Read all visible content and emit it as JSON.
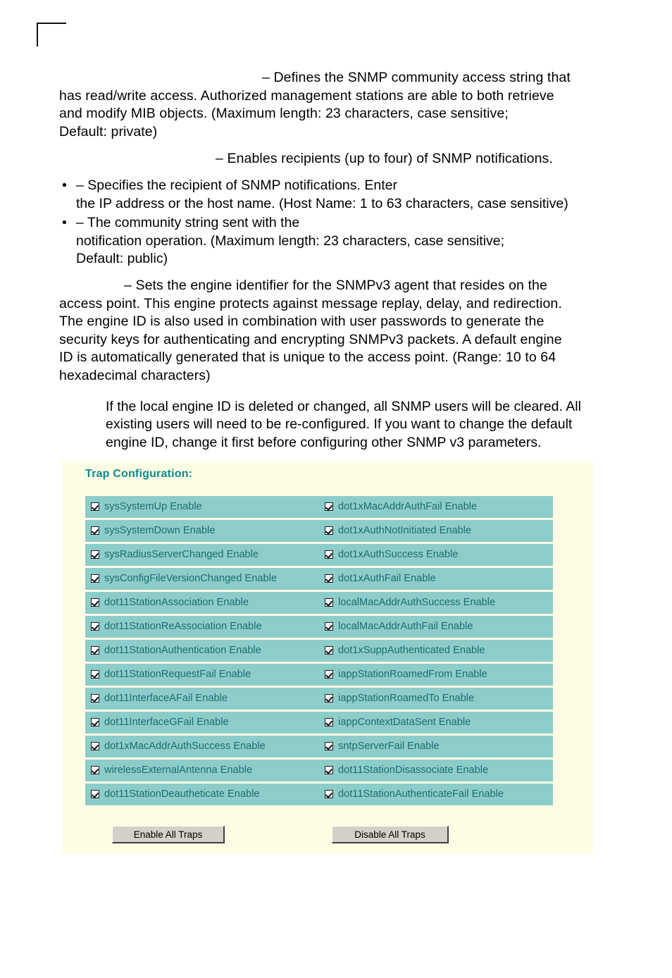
{
  "document": {
    "paragraph_rw_community": "– Defines the SNMP community access string that has read/write access. Authorized management stations are able to both retrieve and modify MIB objects. (Maximum length: 23 characters, case sensitive; Default: private)",
    "paragraph_rw_community_line1": "– Defines the SNMP community access string that",
    "paragraph_rw_community_line2": "has read/write access. Authorized management stations are able to both retrieve",
    "paragraph_rw_community_line3": "and modify MIB objects. (Maximum length: 23 characters, case sensitive;",
    "paragraph_rw_community_line4": "Default: private)",
    "paragraph_trap_destinations": "– Enables recipients (up to four) of SNMP notifications.",
    "bullets": [
      {
        "marker": "•",
        "line1": "– Specifies the recipient of SNMP notifications. Enter",
        "line2": "the IP address or the host name. (Host Name: 1 to 63 characters, case sensitive)"
      },
      {
        "marker": "•",
        "line1": "– The community string sent with the",
        "line2": "notification operation. (Maximum length: 23 characters, case sensitive;",
        "line3": "Default: public)"
      }
    ],
    "paragraph_engine_id_line1": "– Sets the engine identifier for the SNMPv3 agent that resides on the",
    "paragraph_engine_id_line2": "access point. This engine protects against message replay, delay, and redirection.",
    "paragraph_engine_id_line3": "The engine ID is also used in combination with user passwords to generate the",
    "paragraph_engine_id_line4": "security keys for authenticating and encrypting SNMPv3 packets. A default engine",
    "paragraph_engine_id_line5": "ID is automatically generated that is unique to the access point. (Range: 10 to 64",
    "paragraph_engine_id_line6": "hexadecimal characters)",
    "note_line1": "If the local engine ID is deleted or changed, all SNMP users will be cleared. All",
    "note_line2": "existing users will need to be re-configured. If you want to change the default",
    "note_line3": "engine ID, change it first before configuring other SNMP v3 parameters."
  },
  "trap_panel": {
    "title": "Trap Configuration:",
    "panel_background": "#fdfde6",
    "cell_background": "#8dcdc9",
    "cell_text_color": "#1a6e72",
    "title_color": "#0a8a8a",
    "rows": [
      {
        "left": {
          "label": "sysSystemUp Enable",
          "checked": true
        },
        "right": {
          "label": "dot1xMacAddrAuthFail Enable",
          "checked": true
        }
      },
      {
        "left": {
          "label": "sysSystemDown Enable",
          "checked": true
        },
        "right": {
          "label": "dot1xAuthNotInitiated Enable",
          "checked": true
        }
      },
      {
        "left": {
          "label": "sysRadiusServerChanged Enable",
          "checked": true
        },
        "right": {
          "label": "dot1xAuthSuccess Enable",
          "checked": true
        }
      },
      {
        "left": {
          "label": "sysConfigFileVersionChanged Enable",
          "checked": true
        },
        "right": {
          "label": "dot1xAuthFail Enable",
          "checked": true
        }
      },
      {
        "left": {
          "label": "dot11StationAssociation Enable",
          "checked": true
        },
        "right": {
          "label": "localMacAddrAuthSuccess Enable",
          "checked": true
        }
      },
      {
        "left": {
          "label": "dot11StationReAssociation Enable",
          "checked": true
        },
        "right": {
          "label": "localMacAddrAuthFail Enable",
          "checked": true
        }
      },
      {
        "left": {
          "label": "dot11StationAuthentication Enable",
          "checked": true
        },
        "right": {
          "label": "dot1xSuppAuthenticated Enable",
          "checked": true
        }
      },
      {
        "left": {
          "label": "dot11StationRequestFail Enable",
          "checked": true
        },
        "right": {
          "label": "iappStationRoamedFrom Enable",
          "checked": true
        }
      },
      {
        "left": {
          "label": "dot11InterfaceAFail Enable",
          "checked": true
        },
        "right": {
          "label": "iappStationRoamedTo Enable",
          "checked": true
        }
      },
      {
        "left": {
          "label": "dot11InterfaceGFail Enable",
          "checked": true
        },
        "right": {
          "label": "iappContextDataSent Enable",
          "checked": true
        }
      },
      {
        "left": {
          "label": "dot1xMacAddrAuthSuccess Enable",
          "checked": true
        },
        "right": {
          "label": "sntpServerFail Enable",
          "checked": true
        }
      },
      {
        "left": {
          "label": "wirelessExternalAntenna Enable",
          "checked": true
        },
        "right": {
          "label": "dot11StationDisassociate Enable",
          "checked": true
        }
      },
      {
        "left": {
          "label": "dot11StationDeautheticate Enable",
          "checked": true
        },
        "right": {
          "label": "dot11StationAuthenticateFail Enable",
          "checked": true
        }
      }
    ],
    "buttons": {
      "enable_all": "Enable All Traps",
      "disable_all": "Disable All Traps"
    }
  }
}
